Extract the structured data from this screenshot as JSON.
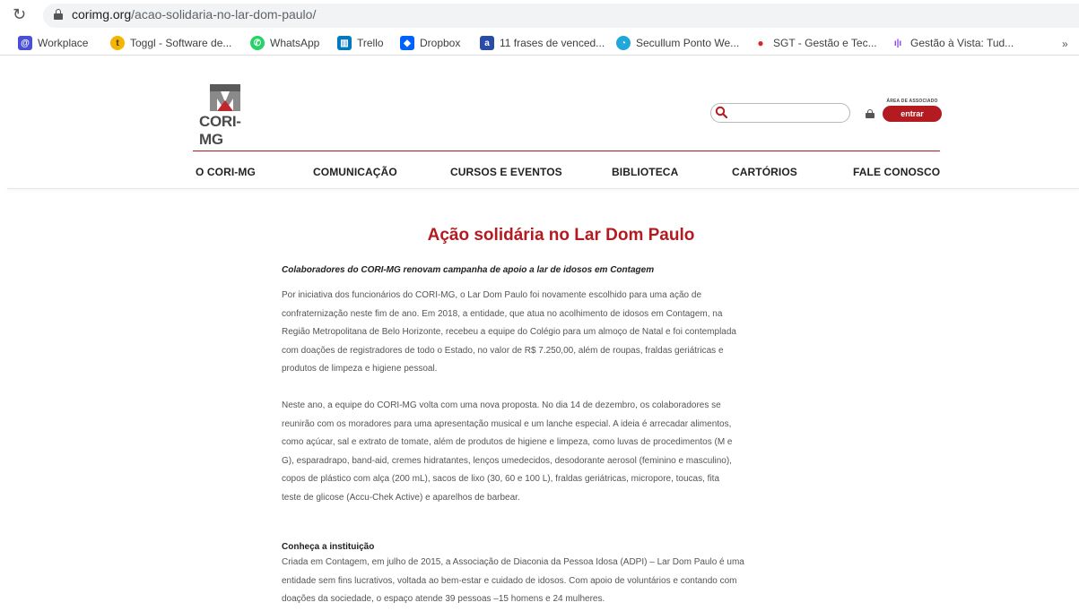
{
  "browser": {
    "url_host": "corimg.org",
    "url_path": "/acao-solidaria-no-lar-dom-paulo/",
    "bookmarks": [
      {
        "label": "Workplace",
        "color": "#4b4fd6",
        "glyph": "@"
      },
      {
        "label": "Toggl - Software de...",
        "color": "#f5b400",
        "glyph": "t"
      },
      {
        "label": "WhatsApp",
        "color": "#25d366",
        "glyph": "✆"
      },
      {
        "label": "Trello",
        "color": "#0079bf",
        "glyph": "▥"
      },
      {
        "label": "Dropbox",
        "color": "#0061ff",
        "glyph": "◆"
      },
      {
        "label": "11 frases de venced...",
        "color": "#2b4ba8",
        "glyph": "a"
      },
      {
        "label": "Secullum Ponto We...",
        "color": "#1ea7d8",
        "glyph": "◔"
      },
      {
        "label": "SGT - Gestão e Tec...",
        "color": "#d62828",
        "glyph": "●"
      },
      {
        "label": "Gestão à Vista: Tud...",
        "color": "#8a3ffc",
        "glyph": "ı|ı"
      }
    ],
    "more": "»"
  },
  "site": {
    "logo_text": "CORI-MG",
    "assoc_label": "ÁREA DE ASSOCIADO",
    "login_label": "entrar",
    "search_placeholder": "",
    "nav": [
      "O CORI-MG",
      "COMUNICAÇÃO",
      "CURSOS E EVENTOS",
      "BIBLIOTECA",
      "CARTÓRIOS",
      "FALE CONOSCO"
    ],
    "brand_color": "#b31b20"
  },
  "article": {
    "title": "Ação solidária no Lar Dom Paulo",
    "subtitle": "Colaboradores do CORI-MG renovam campanha de apoio a lar de idosos em Contagem",
    "p1": [
      "Por iniciativa dos funcionários do CORI-MG, o Lar Dom Paulo foi novamente escolhido para uma ação de",
      "confraternização neste fim de ano. Em 2018, a entidade, que atua no acolhimento de idosos em Contagem, na",
      "Região Metropolitana de Belo Horizonte, recebeu a equipe do Colégio para um almoço de Natal e foi contemplada",
      "com doações de registradores de todo o Estado, no valor de R$ 7.250,00, além de roupas, fraldas geriátricas e",
      "produtos de limpeza e higiene pessoal."
    ],
    "p2": [
      "Neste ano, a equipe do CORI-MG volta com uma nova proposta. No dia 14 de dezembro, os colaboradores se",
      "reunirão com os moradores para uma apresentação musical e um lanche especial. A ideia é arrecadar alimentos,",
      "como açúcar, sal e extrato de tomate, além de produtos de higiene e limpeza, como luvas de procedimentos (M e",
      "G), esparadrapo, band-aid, cremes hidratantes, lenços umedecidos, desodorante aerosol (feminino e masculino),",
      "copos de plástico com alça (200 mL), sacos de lixo (30, 60 e 100 L), fraldas geriátricas, micropore, toucas, fita",
      "teste de glicose (Accu-Chek Active) e aparelhos de barbear."
    ],
    "section_heading": "Conheça a instituição",
    "p3": [
      "Criada em Contagem, em julho de 2015, a Associação de Diaconia da Pessoa Idosa (ADPI) – Lar Dom Paulo é uma",
      "entidade sem fins lucrativos, voltada ao bem-estar e cuidado de idosos. Com apoio de voluntários e contando com",
      "doações da sociedade, o espaço atende 39 pessoas –15 homens e 24 mulheres."
    ]
  }
}
